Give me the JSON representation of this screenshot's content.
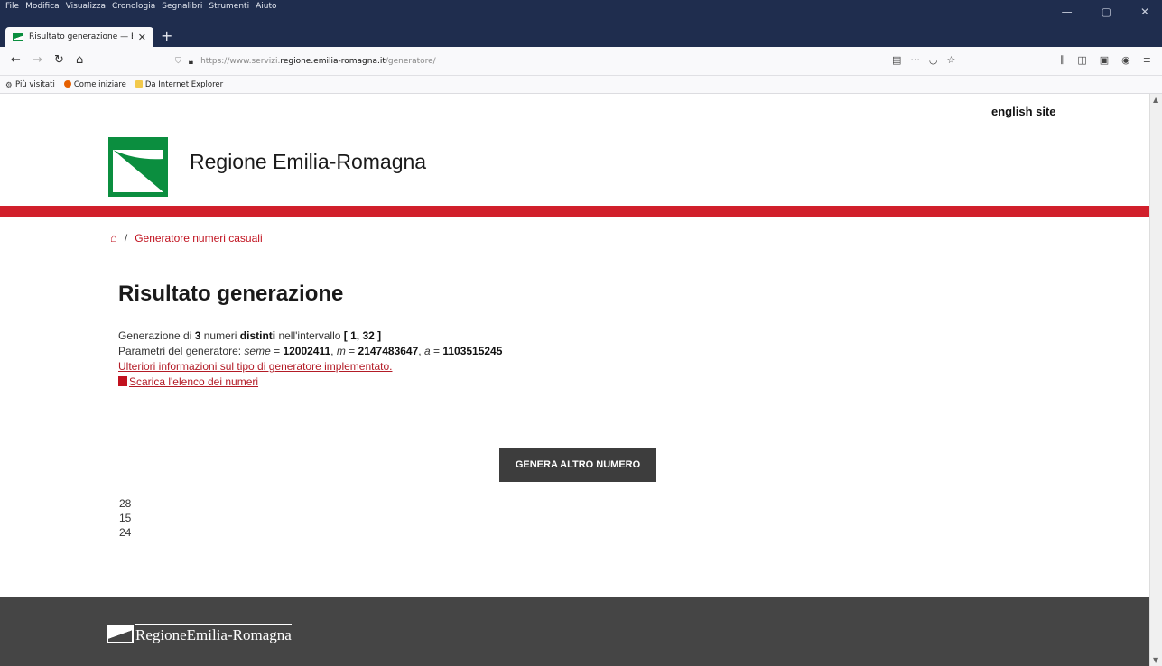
{
  "browser": {
    "menu": [
      "File",
      "Modifica",
      "Visualizza",
      "Cronologia",
      "Segnalibri",
      "Strumenti",
      "Aiuto"
    ],
    "tab_title": "Risultato generazione — E-R",
    "url_prefix": "https://www.servizi.",
    "url_domain": "regione.emilia-romagna.it",
    "url_path": "/generatore/",
    "bookmarks": [
      "Più visitati",
      "Come iniziare",
      "Da Internet Explorer"
    ]
  },
  "header": {
    "english_link": "english site",
    "brand": "Regione Emilia-Romagna"
  },
  "breadcrumb": {
    "current": "Generatore numeri casuali"
  },
  "main": {
    "title": "Risultato generazione",
    "line1_pre": "Generazione di ",
    "count": "3",
    "line1_mid": " numeri ",
    "distinct": "distinti",
    "line1_post": " nell'intervallo ",
    "interval": "[ 1, 32 ]",
    "line2_pre": "Parametri del generatore: ",
    "seed_label": "seme",
    "seed_eq": " = ",
    "seed_value": "12002411",
    "m_label": "m",
    "m_value": "2147483647",
    "a_label": "a",
    "a_value": "1103515245",
    "info_link": "Ulteriori informazioni sul tipo di generatore implementato.",
    "download_link": "Scarica l'elenco dei numeri",
    "button": "GENERA ALTRO NUMERO",
    "numbers": [
      "28",
      "15",
      "24"
    ]
  },
  "footer": {
    "logo_text": "RegioneEmilia-Romagna"
  }
}
